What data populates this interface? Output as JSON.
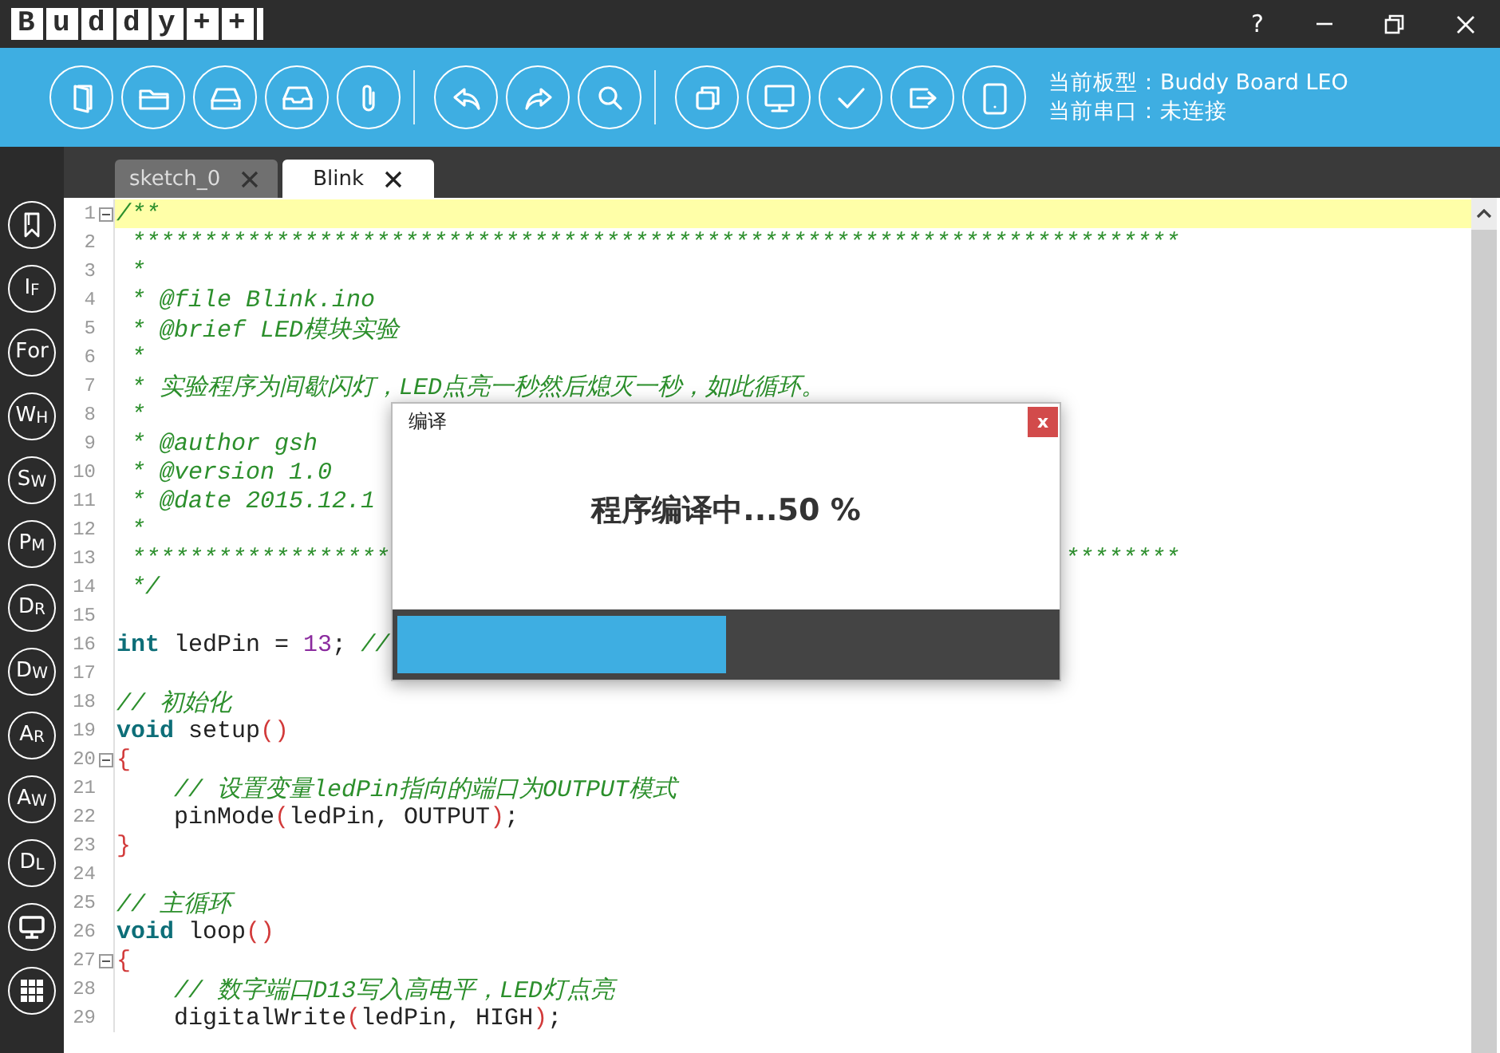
{
  "window": {
    "logo": "Buddy++",
    "help": "?"
  },
  "board_info": {
    "board": "当前板型：Buddy Board LEO",
    "port": "当前串口：未连接"
  },
  "sidebar": {
    "items": [
      {
        "kind": "icon"
      },
      {
        "kind": "text",
        "label": "IF",
        "small_caps": true
      },
      {
        "kind": "text",
        "label": "For",
        "small_caps": false
      },
      {
        "kind": "text",
        "label": "WH",
        "small_caps": true
      },
      {
        "kind": "text",
        "label": "SW",
        "small_caps": true
      },
      {
        "kind": "text",
        "label": "PM",
        "small_caps": true
      },
      {
        "kind": "text",
        "label": "DR",
        "small_caps": true
      },
      {
        "kind": "text",
        "label": "DW",
        "small_caps": true
      },
      {
        "kind": "text",
        "label": "AR",
        "small_caps": true
      },
      {
        "kind": "text",
        "label": "AW",
        "small_caps": true
      },
      {
        "kind": "text",
        "label": "DL",
        "small_caps": true
      },
      {
        "kind": "icon"
      },
      {
        "kind": "icon"
      }
    ]
  },
  "tabs": [
    {
      "label": "sketch_0",
      "selected": false
    },
    {
      "label": "Blink",
      "selected": true
    }
  ],
  "editor": {
    "lines": [
      {
        "number": "1",
        "fold": true,
        "current": true,
        "tokens": [
          {
            "kind": "comment",
            "text": "/**"
          }
        ]
      },
      {
        "number": "2",
        "fold": false,
        "current": false,
        "tokens": [
          {
            "kind": "comment",
            "text": " *************************************************************************"
          }
        ]
      },
      {
        "number": "3",
        "fold": false,
        "current": false,
        "tokens": [
          {
            "kind": "comment",
            "text": " *"
          }
        ]
      },
      {
        "number": "4",
        "fold": false,
        "current": false,
        "tokens": [
          {
            "kind": "comment",
            "text": " * @file Blink.ino"
          }
        ]
      },
      {
        "number": "5",
        "fold": false,
        "current": false,
        "tokens": [
          {
            "kind": "comment",
            "text": " * @brief LED模块实验"
          }
        ]
      },
      {
        "number": "6",
        "fold": false,
        "current": false,
        "tokens": [
          {
            "kind": "comment",
            "text": " *"
          }
        ]
      },
      {
        "number": "7",
        "fold": false,
        "current": false,
        "tokens": [
          {
            "kind": "comment",
            "text": " * 实验程序为间歇闪灯，LED点亮一秒然后熄灭一秒，如此循环。"
          }
        ]
      },
      {
        "number": "8",
        "fold": false,
        "current": false,
        "tokens": [
          {
            "kind": "comment",
            "text": " *"
          }
        ]
      },
      {
        "number": "9",
        "fold": false,
        "current": false,
        "tokens": [
          {
            "kind": "comment",
            "text": " * @author gsh"
          }
        ]
      },
      {
        "number": "10",
        "fold": false,
        "current": false,
        "tokens": [
          {
            "kind": "comment",
            "text": " * @version 1.0"
          }
        ]
      },
      {
        "number": "11",
        "fold": false,
        "current": false,
        "tokens": [
          {
            "kind": "comment",
            "text": " * @date 2015.12.1"
          }
        ]
      },
      {
        "number": "12",
        "fold": false,
        "current": false,
        "tokens": [
          {
            "kind": "comment",
            "text": " *"
          }
        ]
      },
      {
        "number": "13",
        "fold": false,
        "current": false,
        "tokens": [
          {
            "kind": "comment",
            "text": " ******************"
          },
          {
            "kind": "gap"
          },
          {
            "kind": "comment",
            "text": "********"
          }
        ]
      },
      {
        "number": "14",
        "fold": false,
        "current": false,
        "tokens": [
          {
            "kind": "comment",
            "text": " */"
          }
        ]
      },
      {
        "number": "15",
        "fold": false,
        "current": false
      },
      {
        "number": "16",
        "fold": false,
        "current": false,
        "tokens": [
          {
            "kind": "keyword",
            "text": "int"
          },
          {
            "kind": "plain",
            "text": " ledPin = "
          },
          {
            "kind": "number",
            "text": "13"
          },
          {
            "kind": "plain",
            "text": "; "
          },
          {
            "kind": "comment",
            "text": "//"
          }
        ]
      },
      {
        "number": "17",
        "fold": false,
        "current": false
      },
      {
        "number": "18",
        "fold": false,
        "current": false,
        "tokens": [
          {
            "kind": "comment",
            "text": "// 初始化"
          }
        ]
      },
      {
        "number": "19",
        "fold": false,
        "current": false,
        "tokens": [
          {
            "kind": "keyword",
            "text": "void"
          },
          {
            "kind": "plain",
            "text": " setup"
          },
          {
            "kind": "paren",
            "text": "()"
          }
        ]
      },
      {
        "number": "20",
        "fold": true,
        "current": false,
        "tokens": [
          {
            "kind": "paren",
            "text": "{"
          }
        ]
      },
      {
        "number": "21",
        "fold": false,
        "current": false,
        "indent": true,
        "tokens": [
          {
            "kind": "comment",
            "text": "// 设置变量ledPin指向的端口为OUTPUT模式"
          }
        ]
      },
      {
        "number": "22",
        "fold": false,
        "current": false,
        "indent": true,
        "tokens": [
          {
            "kind": "plain",
            "text": "pinMode"
          },
          {
            "kind": "paren",
            "text": "("
          },
          {
            "kind": "plain",
            "text": "ledPin, OUTPUT"
          },
          {
            "kind": "paren",
            "text": ")"
          },
          {
            "kind": "plain",
            "text": ";"
          }
        ]
      },
      {
        "number": "23",
        "fold": false,
        "current": false,
        "tokens": [
          {
            "kind": "paren",
            "text": "}"
          }
        ]
      },
      {
        "number": "24",
        "fold": false,
        "current": false
      },
      {
        "number": "25",
        "fold": false,
        "current": false,
        "tokens": [
          {
            "kind": "comment",
            "text": "// 主循环"
          }
        ]
      },
      {
        "number": "26",
        "fold": false,
        "current": false,
        "tokens": [
          {
            "kind": "keyword",
            "text": "void"
          },
          {
            "kind": "plain",
            "text": " loop"
          },
          {
            "kind": "paren",
            "text": "()"
          }
        ]
      },
      {
        "number": "27",
        "fold": true,
        "current": false,
        "tokens": [
          {
            "kind": "paren",
            "text": "{"
          }
        ]
      },
      {
        "number": "28",
        "fold": false,
        "current": false,
        "indent": true,
        "tokens": [
          {
            "kind": "comment",
            "text": "// 数字端口D13写入高电平，LED灯点亮"
          }
        ]
      },
      {
        "number": "29",
        "fold": false,
        "current": false,
        "indent": true,
        "tokens": [
          {
            "kind": "plain",
            "text": "digitalWrite"
          },
          {
            "kind": "paren",
            "text": "("
          },
          {
            "kind": "plain",
            "text": "ledPin, HIGH"
          },
          {
            "kind": "paren",
            "text": ")"
          },
          {
            "kind": "plain",
            "text": ";"
          }
        ]
      }
    ]
  },
  "dialog": {
    "title": "编译",
    "close": "x",
    "message": "程序编译中...50 %",
    "progress": {
      "level": 0.5
    }
  }
}
